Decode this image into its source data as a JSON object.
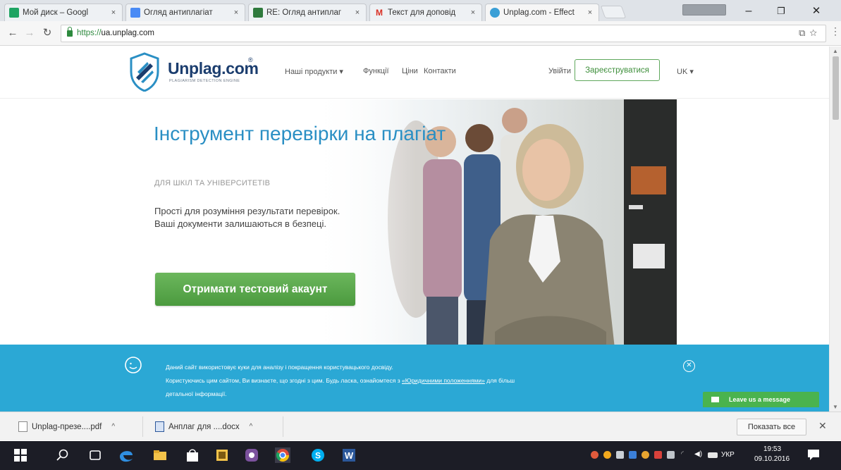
{
  "browser": {
    "tabs": [
      {
        "label": "Мой диск – Googl",
        "favicon_color": "#1fa463",
        "active": false
      },
      {
        "label": "Огляд антиплагіат",
        "favicon_color": "#4a8bf5",
        "active": false
      },
      {
        "label": "RE: Огляд антиплаг",
        "favicon_color": "#2f7a3d",
        "active": false
      },
      {
        "label": "Текст для доповід",
        "favicon_color": "#d93025",
        "active": false
      },
      {
        "label": "Unplag.com - Effect",
        "favicon_color": "#3a9fd6",
        "active": true
      }
    ],
    "tab_close": "×",
    "window_controls": {
      "minimize": "–",
      "maximize": "❐",
      "close": "✕"
    },
    "url_scheme": "https://",
    "url_host": "ua.unplag.com",
    "omnibox_icons": [
      "translate-icon",
      "star-icon"
    ],
    "menu_icon": "⋮"
  },
  "site": {
    "logo_text": "Unplag.com",
    "logo_reg": "®",
    "logo_tagline": "PLAGIARISM DETECTION ENGINE",
    "nav": {
      "products": "Наші продукти ▾",
      "features": "Функції",
      "prices": "Ціни",
      "contacts": "Контакти"
    },
    "login": "Увійти",
    "register": "Зареєструватися",
    "lang": "UK ▾",
    "hero": {
      "title": "Інструмент перевірки на плагіат",
      "subtitle": "ДЛЯ ШКІЛ ТА УНІВЕРСИТЕТІВ",
      "desc_line1": "Прості для розуміння результати перевірок.",
      "desc_line2": "Ваші документи залишаються в безпеці.",
      "cta": "Отримати тестовий акаунт"
    },
    "cookie": {
      "line1": "Даний сайт використовує куки для аналізу і покращення користувацького досвіду.",
      "line2_start": "Користуючись цим сайтом, Ви визнаєте, що згодні з цим. Будь ласка, ознайомтеся з ",
      "line2_link": "«Юридичними положеннями»",
      "line2_end": " для більш",
      "line3": "детальної інформації.",
      "close": "✕"
    },
    "chat": "Leave us a message"
  },
  "downloads": {
    "items": [
      {
        "name": "Unplag-презе....pdf",
        "type": "pdf"
      },
      {
        "name": "Анплаг для ....docx",
        "type": "docx"
      }
    ],
    "caret": "^",
    "show_all": "Показать все",
    "close": "✕"
  },
  "taskbar": {
    "lang": "УКР",
    "time": "19:53",
    "date": "09.10.2016"
  },
  "colors": {
    "brand_blue": "#2a8fc4",
    "cta_green": "#4b9a3e",
    "cookie_bar": "#2ba8d5",
    "logo_navy": "#1b3d6e"
  }
}
